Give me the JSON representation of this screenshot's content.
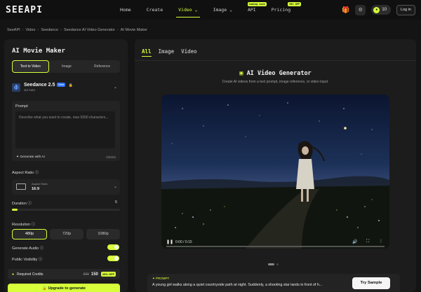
{
  "nav": {
    "logo": "SEEAPI",
    "links": [
      {
        "label": "Home",
        "arrow": ""
      },
      {
        "label": "Create",
        "arrow": ""
      },
      {
        "label": "Video",
        "arrow": "⌄"
      },
      {
        "label": "Image",
        "arrow": "⌄"
      },
      {
        "label": "API",
        "arrow": "",
        "tag": "Coming soon"
      },
      {
        "label": "Pricing",
        "arrow": "",
        "tag": "50% OFF"
      }
    ],
    "credits": "10",
    "login": "Log in"
  },
  "breadcrumb": [
    "SeeAPI",
    "Video",
    "Seedance",
    "Seedance AI Video Generator",
    "AI Movie Maker"
  ],
  "left": {
    "title": "AI Movie Maker",
    "modes": [
      "Text to Video",
      "Image",
      "Reference"
    ],
    "model": {
      "name": "Seedance 2.5",
      "badge": "Beta",
      "sub": "via Auto"
    },
    "prompt_label": "Prompt",
    "prompt_placeholder": "Describe what you want to create, max 5000 characters...",
    "generate_ai": "Generate with AI",
    "counter": "0/5000",
    "aspect_label": "Aspect Ratio",
    "aspect_sub": "Aspect Ratio",
    "aspect_value": "16:9",
    "duration_label": "Duration",
    "duration_value": "5",
    "duration_fraction": 0.05,
    "resolution_label": "Resolution",
    "resolutions": [
      "480p",
      "720p",
      "1080p"
    ],
    "audio_label": "Generate Audio",
    "visibility_label": "Public Visibility",
    "credits_label": "Required Credits",
    "credits_old": "200",
    "credits_new": "150",
    "credits_off": "25% OFF",
    "upgrade": "Upgrade to generate"
  },
  "right": {
    "tabs": [
      "All",
      "Image",
      "Video"
    ],
    "title": "AI Video Generator",
    "subtitle": "Create AI videos from a text prompt, image reference, or video input.",
    "time": "0:00 / 0:15",
    "prompt_label": "PROMPT",
    "prompt_text": "A young girl walks along a quiet countryside path at night. Suddenly, a shooting star lands in front of h...",
    "try": "Try Sample"
  },
  "icons": {
    "gift": "gift-icon",
    "settings": "settings-icon",
    "play": "play-icon",
    "volume": "volume-icon",
    "fullscreen": "fullscreen-icon",
    "more": "more-icon"
  },
  "colors": {
    "accent": "#d7ff3a",
    "panel": "#1c1c1c",
    "bg": "#141414"
  }
}
